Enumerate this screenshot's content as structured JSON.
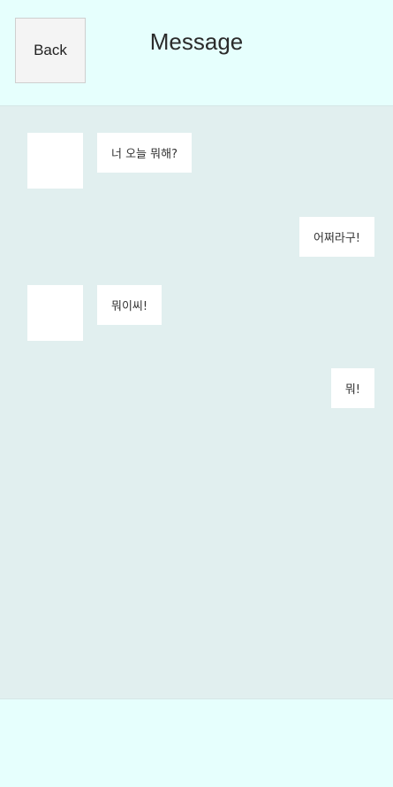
{
  "header": {
    "back_label": "Back",
    "title": "Message"
  },
  "messages": [
    {
      "side": "left",
      "text": "너 오늘 뭐해?"
    },
    {
      "side": "right",
      "text": "어쩌라구!"
    },
    {
      "side": "left",
      "text": "뭐이씨!"
    },
    {
      "side": "right",
      "text": "뭐!"
    }
  ]
}
